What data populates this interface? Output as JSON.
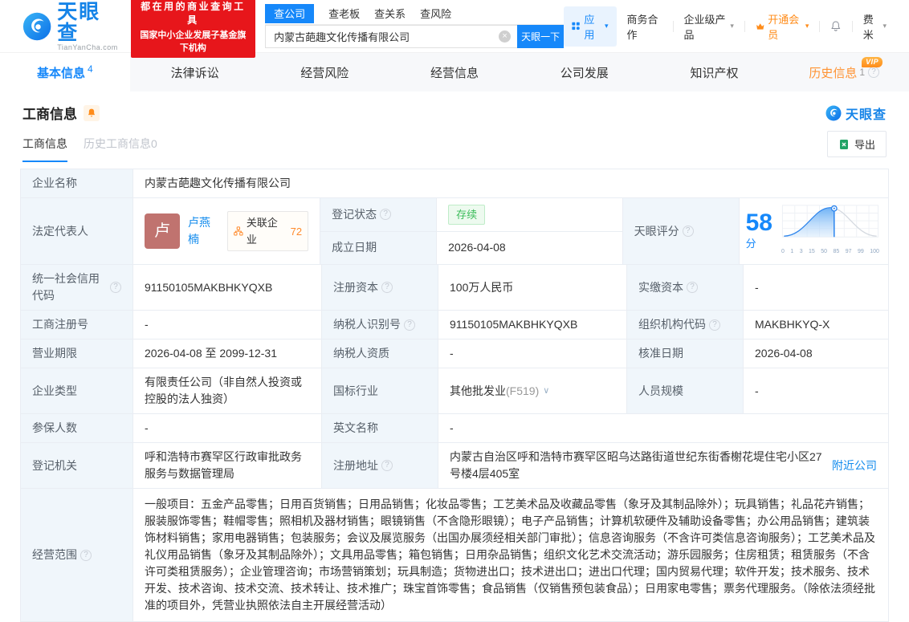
{
  "colors": {
    "brand_blue": "#1688fa",
    "link_blue": "#128bed",
    "vip_orange": "#ff8c1a",
    "banner_red": "#e7161b",
    "status_green": "#3dbd5b"
  },
  "icons": {
    "help": "?",
    "clear": "×",
    "caret": "▾",
    "chevron": "∨",
    "names": [
      "tianyancha-eye-icon",
      "apps-grid-icon",
      "vip-crown-icon",
      "notification-bell-icon",
      "excel-file-icon",
      "related-companies-icon",
      "help-icon",
      "clear-icon",
      "chevron-down-icon"
    ]
  },
  "header": {
    "logo": {
      "brand": "天眼查",
      "domain": "TianYanCha.com"
    },
    "banner": {
      "line1": "都在用的商业查询工具",
      "line2": "国家中小企业发展子基金旗下机构"
    },
    "search": {
      "tabs": [
        {
          "label": "查公司",
          "active": true
        },
        {
          "label": "查老板"
        },
        {
          "label": "查关系"
        },
        {
          "label": "查风险"
        }
      ],
      "value": "内蒙古葩趣文化传播有限公司",
      "button": "天眼一下"
    },
    "nav": {
      "apps": "应用",
      "biz": "商务合作",
      "enterprise": "企业级产品",
      "vip": "开通会员",
      "user": "费米"
    }
  },
  "main_tabs": [
    {
      "label": "基本信息",
      "count": "4",
      "active": true
    },
    {
      "label": "法律诉讼"
    },
    {
      "label": "经营风险"
    },
    {
      "label": "经营信息"
    },
    {
      "label": "公司发展"
    },
    {
      "label": "知识产权"
    },
    {
      "label": "历史信息",
      "count": "1",
      "vip": "VIP"
    }
  ],
  "section": {
    "title": "工商信息",
    "watermark": "天眼查",
    "subtabs": [
      {
        "label": "工商信息",
        "active": true
      },
      {
        "label": "历史工商信息0"
      }
    ],
    "export_label": "导出"
  },
  "table": {
    "fields": {
      "company_name": {
        "label": "企业名称",
        "value": "内蒙古葩趣文化传播有限公司"
      },
      "legal_rep": {
        "label": "法定代表人",
        "avatar": "卢",
        "name": "卢燕楠",
        "badge": "关联企业",
        "count": "72"
      },
      "reg_status": {
        "label": "登记状态",
        "value": "存续"
      },
      "established": {
        "label": "成立日期",
        "value": "2026-04-08"
      },
      "score": {
        "label": "天眼评分",
        "value": "58",
        "unit": "分",
        "ticks": [
          "0",
          "1",
          "3",
          "15",
          "50",
          "85",
          "97",
          "99",
          "100"
        ]
      },
      "credit_code": {
        "label": "统一社会信用代码",
        "value": "91150105MAKBHKYQXB"
      },
      "reg_capital": {
        "label": "注册资本",
        "value": "100万人民币"
      },
      "paid_capital": {
        "label": "实缴资本",
        "value": "-"
      },
      "reg_number": {
        "label": "工商注册号",
        "value": "-"
      },
      "taxpayer_id": {
        "label": "纳税人识别号",
        "value": "91150105MAKBHKYQXB"
      },
      "org_code": {
        "label": "组织机构代码",
        "value": "MAKBHKYQ-X"
      },
      "business_term": {
        "label": "营业期限",
        "value": "2026-04-08 至 2099-12-31"
      },
      "taxpayer_quality": {
        "label": "纳税人资质",
        "value": "-"
      },
      "approval_date": {
        "label": "核准日期",
        "value": "2026-04-08"
      },
      "company_type": {
        "label": "企业类型",
        "value": "有限责任公司（非自然人投资或控股的法人独资）"
      },
      "industry": {
        "label": "国标行业",
        "value": "其他批发业",
        "code": "(F519)"
      },
      "staff_size": {
        "label": "人员规模",
        "value": "-"
      },
      "insured_count": {
        "label": "参保人数",
        "value": "-"
      },
      "english_name": {
        "label": "英文名称",
        "value": "-"
      },
      "reg_authority": {
        "label": "登记机关",
        "value": "呼和浩特市赛罕区行政审批政务服务与数据管理局"
      },
      "reg_address": {
        "label": "注册地址",
        "value": "内蒙古自治区呼和浩特市赛罕区昭乌达路街道世纪东街香榭花堤住宅小区27号楼4层405室",
        "link": "附近公司"
      },
      "business_scope": {
        "label": "经营范围",
        "value": "一般项目：五金产品零售；日用百货销售；日用品销售；化妆品零售；工艺美术品及收藏品零售（象牙及其制品除外）；玩具销售；礼品花卉销售；服装服饰零售；鞋帽零售；照相机及器材销售；眼镜销售（不含隐形眼镜）；电子产品销售；计算机软硬件及辅助设备零售；办公用品销售；建筑装饰材料销售；家用电器销售；包装服务；会议及展览服务（出国办展须经相关部门审批）；信息咨询服务（不含许可类信息咨询服务）；工艺美术品及礼仪用品销售（象牙及其制品除外）；文具用品零售；箱包销售；日用杂品销售；组织文化艺术交流活动；游乐园服务；住房租赁；租赁服务（不含许可类租赁服务）；企业管理咨询；市场营销策划；玩具制造；货物进出口；技术进出口；进出口代理；国内贸易代理；软件开发；技术服务、技术开发、技术咨询、技术交流、技术转让、技术推广；珠宝首饰零售；食品销售（仅销售预包装食品）；日用家电零售；票务代理服务。（除依法须经批准的项目外，凭营业执照依法自主开展经营活动）"
      }
    }
  }
}
